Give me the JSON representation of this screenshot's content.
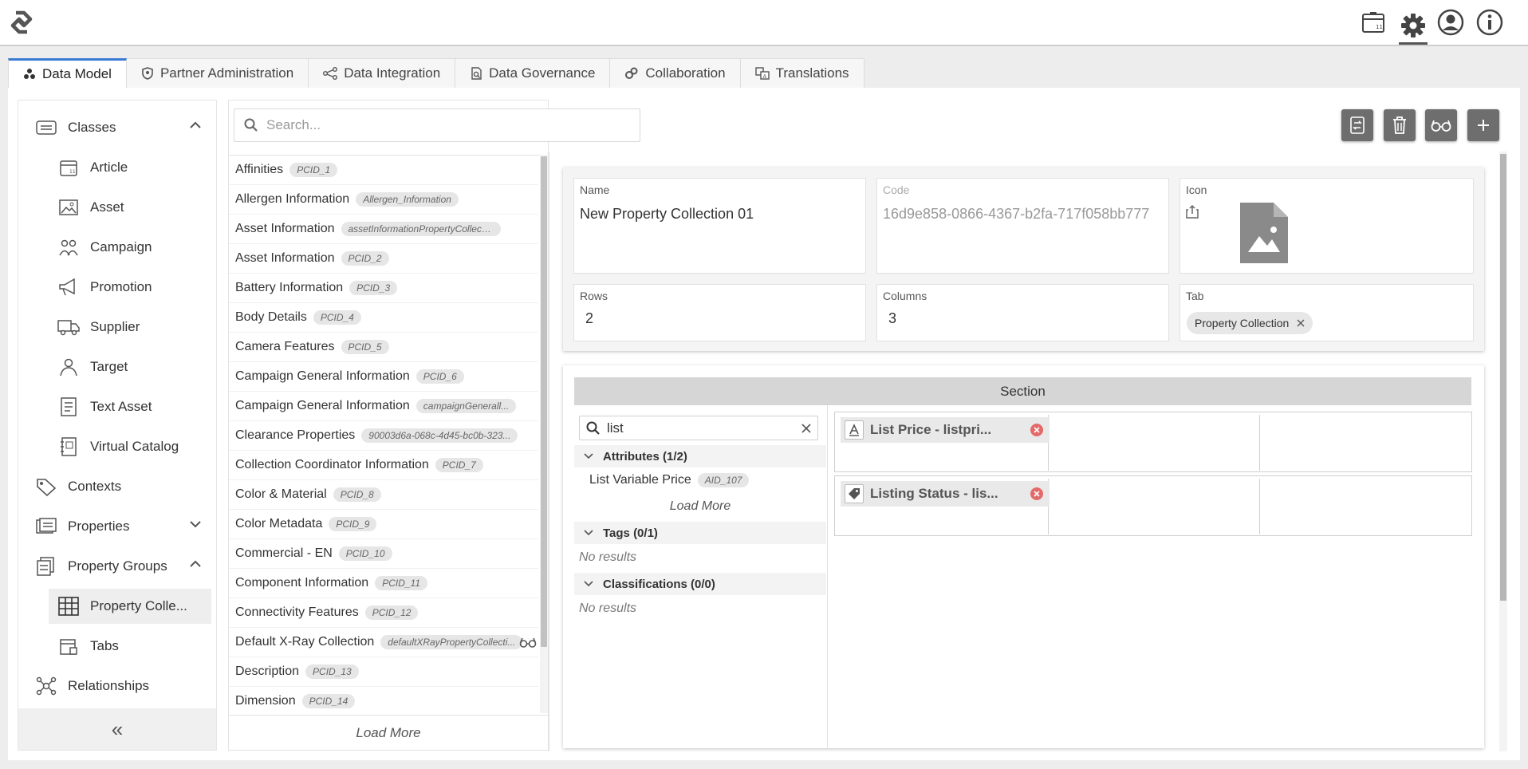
{
  "tabs": [
    {
      "label": "Data Model",
      "icon": "data-model-icon"
    },
    {
      "label": "Partner Administration",
      "icon": "shield-icon"
    },
    {
      "label": "Data Integration",
      "icon": "integration-icon"
    },
    {
      "label": "Data Governance",
      "icon": "governance-icon"
    },
    {
      "label": "Collaboration",
      "icon": "collaboration-icon"
    },
    {
      "label": "Translations",
      "icon": "translations-icon"
    }
  ],
  "sidebar": {
    "items": [
      {
        "label": "Classes",
        "icon": "classes-icon",
        "expanded": true
      },
      {
        "label": "Article",
        "icon": "article-icon"
      },
      {
        "label": "Asset",
        "icon": "asset-icon"
      },
      {
        "label": "Campaign",
        "icon": "campaign-icon"
      },
      {
        "label": "Promotion",
        "icon": "megaphone-icon"
      },
      {
        "label": "Supplier",
        "icon": "truck-icon"
      },
      {
        "label": "Target",
        "icon": "target-icon"
      },
      {
        "label": "Text Asset",
        "icon": "text-asset-icon"
      },
      {
        "label": "Virtual Catalog",
        "icon": "catalog-icon"
      },
      {
        "label": "Contexts",
        "icon": "tag-icon"
      },
      {
        "label": "Properties",
        "icon": "properties-icon",
        "expanded": false
      },
      {
        "label": "Property Groups",
        "icon": "property-groups-icon",
        "expanded": true
      },
      {
        "label": "Property Colle...",
        "icon": "table-icon",
        "selected": true
      },
      {
        "label": "Tabs",
        "icon": "tabs-icon"
      },
      {
        "label": "Relationships",
        "icon": "relationships-icon"
      }
    ],
    "collapse_label": "«"
  },
  "list": {
    "search_placeholder": "Search...",
    "items": [
      {
        "name": "Affinities",
        "code": "PCID_1"
      },
      {
        "name": "Allergen Information",
        "code": "Allergen_Information"
      },
      {
        "name": "Asset Information",
        "code": "assetInformationPropertyCollection"
      },
      {
        "name": "Asset Information",
        "code": "PCID_2"
      },
      {
        "name": "Battery Information",
        "code": "PCID_3"
      },
      {
        "name": "Body Details",
        "code": "PCID_4"
      },
      {
        "name": "Camera Features",
        "code": "PCID_5"
      },
      {
        "name": "Campaign General Information",
        "code": "PCID_6"
      },
      {
        "name": "Campaign General Information",
        "code": "campaignGenerall..."
      },
      {
        "name": "Clearance Properties",
        "code": "90003d6a-068c-4d45-bc0b-323..."
      },
      {
        "name": "Collection Coordinator Information",
        "code": "PCID_7"
      },
      {
        "name": "Color & Material",
        "code": "PCID_8"
      },
      {
        "name": "Color Metadata",
        "code": "PCID_9"
      },
      {
        "name": "Commercial - EN",
        "code": "PCID_10"
      },
      {
        "name": "Component Information",
        "code": "PCID_11"
      },
      {
        "name": "Connectivity Features",
        "code": "PCID_12"
      },
      {
        "name": "Default X-Ray Collection",
        "code": "defaultXRayPropertyCollecti..."
      },
      {
        "name": "Description",
        "code": "PCID_13"
      },
      {
        "name": "Dimension",
        "code": "PCID_14"
      }
    ],
    "load_more": "Load More"
  },
  "details": {
    "name_label": "Name",
    "name_value": "New Property Collection 01",
    "code_label": "Code",
    "code_value": "16d9e858-0866-4367-b2fa-717f058bb777",
    "icon_label": "Icon",
    "rows_label": "Rows",
    "rows_value": "2",
    "columns_label": "Columns",
    "columns_value": "3",
    "tab_label": "Tab",
    "tab_value": "Property Collection"
  },
  "section": {
    "header": "Section",
    "filter_value": "list",
    "attributes_label": "Attributes (1/2)",
    "attribute_item": "List Variable Price",
    "attribute_code": "AID_107",
    "attributes_load_more": "Load More",
    "tags_label": "Tags (0/1)",
    "tags_empty": "No results",
    "classifications_label": "Classifications (0/0)",
    "classifications_empty": "No results",
    "cells": [
      {
        "label": "List Price - listpri...",
        "icon": "text-attribute-icon"
      },
      {
        "label": "Listing Status - lis...",
        "icon": "tag-attribute-icon"
      }
    ]
  }
}
